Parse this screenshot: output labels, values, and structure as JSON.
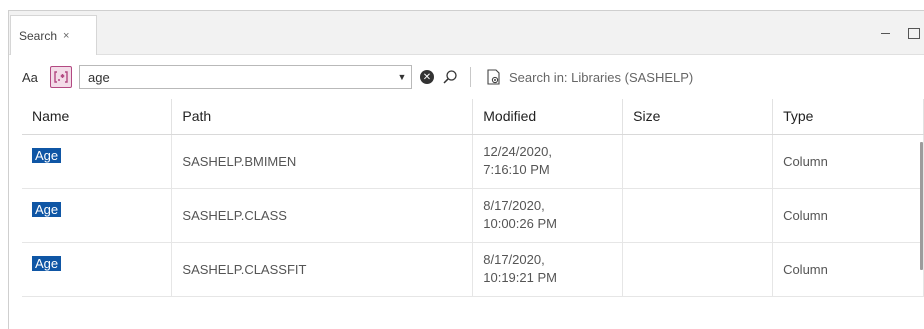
{
  "tab": {
    "label": "Search",
    "close": "×"
  },
  "toolbar": {
    "case_label": "Aa",
    "regex_glyph": "[.*]",
    "search_value": "age",
    "scope_text": "Search in: Libraries (SASHELP)"
  },
  "table": {
    "columns": [
      "Name",
      "Path",
      "Modified",
      "Size",
      "Type"
    ],
    "rows": [
      {
        "name": "Age",
        "path": "SASHELP.BMIMEN",
        "modified_date": "12/24/2020,",
        "modified_time": "7:16:10 PM",
        "size": "",
        "type": "Column"
      },
      {
        "name": "Age",
        "path": "SASHELP.CLASS",
        "modified_date": "8/17/2020,",
        "modified_time": "10:00:26 PM",
        "size": "",
        "type": "Column"
      },
      {
        "name": "Age",
        "path": "SASHELP.CLASSFIT",
        "modified_date": "8/17/2020,",
        "modified_time": "10:19:21 PM",
        "size": "",
        "type": "Column"
      }
    ]
  },
  "colors": {
    "highlight": "#0f56a5",
    "regex_accent": "#b34982"
  }
}
